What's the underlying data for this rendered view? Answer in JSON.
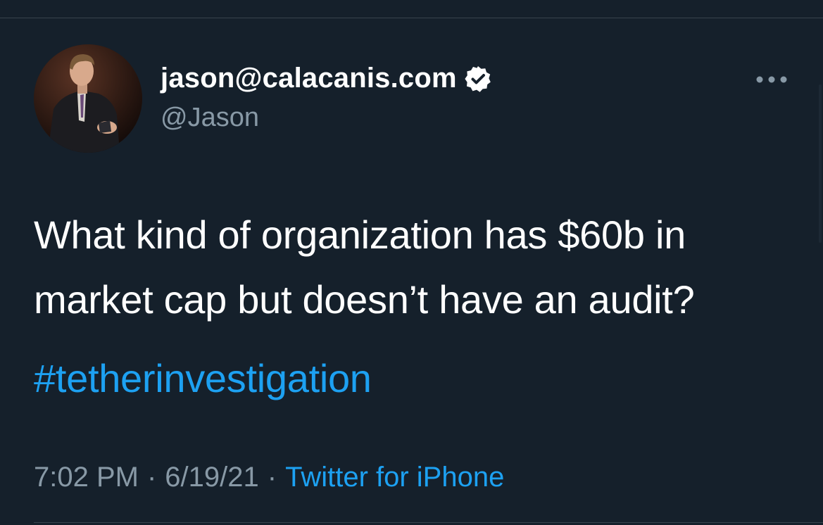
{
  "tweet": {
    "author": {
      "display_name": "jason@calacanis.com",
      "handle": "@Jason",
      "verified_icon": "verified-badge-icon",
      "avatar_icon": "profile-photo"
    },
    "more_icon": "more-options-icon",
    "text": "What kind of organization has $60b in market cap but doesn’t have an audit?",
    "hashtag": "#tetherinvestigation",
    "time": "7:02 PM",
    "separator": "·",
    "date": "6/19/21",
    "source": "Twitter for iPhone"
  },
  "colors": {
    "background": "#15202b",
    "primary_text": "#ffffff",
    "secondary_text": "#8899a6",
    "link": "#1da1f2",
    "divider": "#38444d"
  }
}
